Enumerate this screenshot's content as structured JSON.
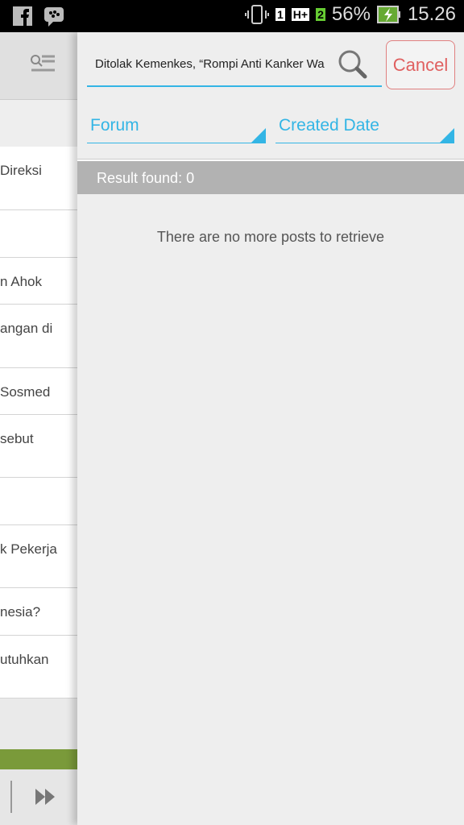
{
  "status_bar": {
    "battery": "56%",
    "time": "15.26",
    "sim1": "1",
    "sim2": "2",
    "network": "H+"
  },
  "sidebar": {
    "items": [
      {
        "label": "Direksi"
      },
      {
        "label": ""
      },
      {
        "label": "n Ahok"
      },
      {
        "label": "angan di"
      },
      {
        "label": "Sosmed"
      },
      {
        "label": "sebut"
      },
      {
        "label": ""
      },
      {
        "label": "k Pekerja"
      },
      {
        "label": "nesia?"
      },
      {
        "label": "utuhkan"
      }
    ]
  },
  "search": {
    "value": "Ditolak Kemenkes, “Rompi Anti Kanker Wa",
    "cancel_label": "Cancel"
  },
  "filters": {
    "forum": "Forum",
    "created_date": "Created Date"
  },
  "results": {
    "label": "Result found: 0",
    "empty_message": "There are no more posts to retrieve"
  },
  "colors": {
    "accent": "#33b5e5",
    "cancel": "#e06060",
    "bar": "#7a9a3a"
  }
}
